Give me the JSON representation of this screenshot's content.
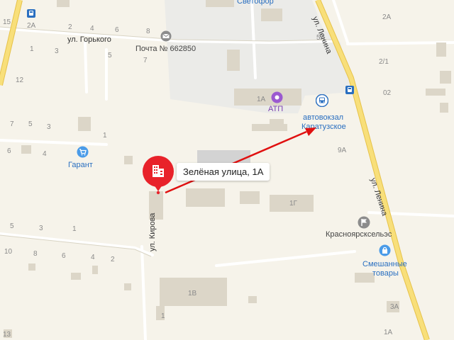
{
  "map": {
    "streets": {
      "gorkogo": "ул. Горького",
      "lenina_top": "ул. Ленина",
      "lenina_right": "ул. Ленина",
      "kirova": "ул. Кирова"
    },
    "pois": {
      "post": "Почта № 662850",
      "atp": "АТП",
      "bus_station_line1": "автовокзал",
      "bus_station_line2": "Каратузское",
      "garant": "Гарант",
      "krasnoyarsk": "Красноярсксельэс",
      "shop_line1": "Смешанные",
      "shop_line2": "товары",
      "svetofor": "Светофор"
    },
    "selected_address": "Зелёная улица, 1А",
    "house_numbers": {
      "n15": "15",
      "n2A_left": "2А",
      "n2": "2",
      "n4": "4",
      "n6": "6",
      "n8": "8",
      "n1_a": "1",
      "n3_a": "3",
      "n5_a": "5",
      "n7_a": "7",
      "n12": "12",
      "n7_b": "7",
      "n5_b": "5",
      "n3_b": "3",
      "n1_b": "1",
      "n6_c": "6",
      "n4_c": "4",
      "n1A": "1А",
      "n9A": "9А",
      "n1G": "1Г",
      "n5_d": "5",
      "n3_d": "3",
      "n1_d": "1",
      "n10": "10",
      "n8_e": "8",
      "n6_e": "6",
      "n4_e": "4",
      "n2_e": "2",
      "n13": "13",
      "n1V": "1В",
      "n1_f": "1",
      "n5A": "5А",
      "n2A_right": "2А",
      "n2_1": "2/1",
      "n02": "02",
      "n3A": "3А",
      "n1A_bottom": "1А"
    },
    "colors": {
      "background": "#f6f3ea",
      "road_major": "#f5d35a",
      "marker_red": "#e8222a",
      "arrow": "#e01010",
      "poi_blue": "#2a6fc0"
    }
  }
}
